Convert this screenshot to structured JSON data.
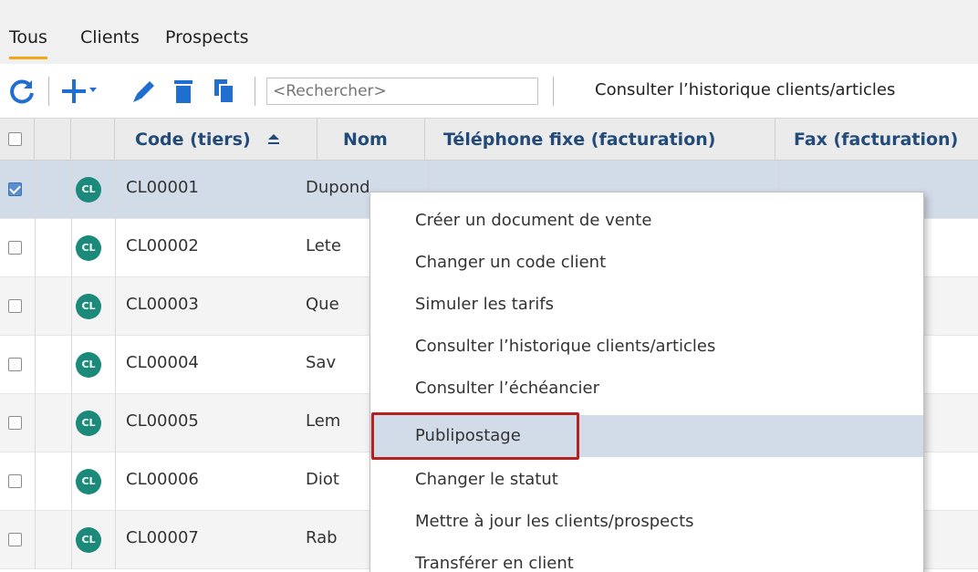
{
  "tabs": [
    {
      "label": "Tous",
      "active": true
    },
    {
      "label": "Clients",
      "active": false
    },
    {
      "label": "Prospects",
      "active": false
    }
  ],
  "toolbar": {
    "refresh_icon": "refresh-icon",
    "add_icon": "plus-dropdown-icon",
    "edit_icon": "pencil-icon",
    "delete_icon": "trash-icon",
    "copy_icon": "copy-icon",
    "search_placeholder": "<Rechercher>",
    "history_link": "Consulter l’historique clients/articles"
  },
  "grid": {
    "columns": [
      {
        "label": "Code (tiers)",
        "sort": "asc"
      },
      {
        "label": "Nom"
      },
      {
        "label": "Téléphone fixe (facturation)"
      },
      {
        "label": "Fax (facturation)"
      }
    ],
    "rows": [
      {
        "badge": "CL",
        "code": "CL00001",
        "nom": "Dupond",
        "selected": true
      },
      {
        "badge": "CL",
        "code": "CL00002",
        "nom": "Lete",
        "selected": false
      },
      {
        "badge": "CL",
        "code": "CL00003",
        "nom": "Que",
        "selected": false
      },
      {
        "badge": "CL",
        "code": "CL00004",
        "nom": "Sav",
        "selected": false
      },
      {
        "badge": "CL",
        "code": "CL00005",
        "nom": "Lem",
        "selected": false
      },
      {
        "badge": "CL",
        "code": "CL00006",
        "nom": "Diot",
        "selected": false
      },
      {
        "badge": "CL",
        "code": "CL00007",
        "nom": "Rab",
        "selected": false
      }
    ]
  },
  "context_menu": {
    "items": [
      {
        "label": "Créer un document de vente"
      },
      {
        "label": "Changer un code client"
      },
      {
        "label": "Simuler les tarifs"
      },
      {
        "label": "Consulter l’historique clients/articles"
      },
      {
        "label": "Consulter l’échéancier"
      },
      {
        "label": "Publipostage",
        "highlighted": true
      },
      {
        "label": "Changer le statut"
      },
      {
        "label": "Mettre à jour les clients/prospects"
      },
      {
        "label": "Transférer en client"
      }
    ]
  },
  "colors": {
    "tab_active_underline": "#f2a713",
    "icon_blue": "#1f6fd1",
    "header_text": "#234b7a",
    "badge_green": "#1b8a7a",
    "selection": "#d2dbe8",
    "highlight_box": "#b52020"
  }
}
